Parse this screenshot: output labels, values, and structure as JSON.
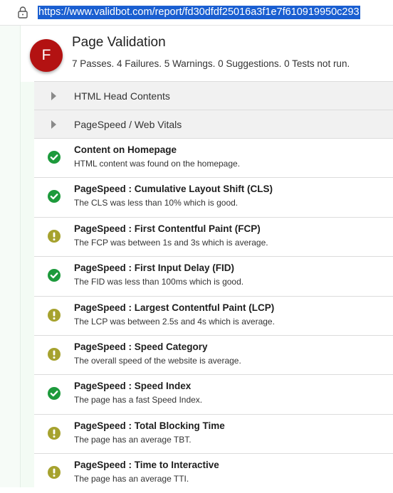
{
  "browser": {
    "url": "https://www.validbot.com/report/fd30dfdf25016a3f1e7f610919950c293"
  },
  "header": {
    "avatar_letter": "F",
    "avatar_color": "#b31212",
    "title": "Page Validation",
    "summary": "7 Passes. 4 Failures. 5 Warnings. 0 Suggestions. 0 Tests not run."
  },
  "sections": [
    {
      "label": "HTML Head Contents"
    },
    {
      "label": "PageSpeed / Web Vitals"
    }
  ],
  "status_colors": {
    "pass": "#1d9a3c",
    "warning": "#a6a22e"
  },
  "checks": [
    {
      "status": "pass",
      "icon": "check-circle-icon",
      "title": "Content on Homepage",
      "desc": "HTML content was found on the homepage."
    },
    {
      "status": "pass",
      "icon": "check-circle-icon",
      "title": "PageSpeed : Cumulative Layout Shift (CLS)",
      "desc": "The CLS was less than 10% which is good."
    },
    {
      "status": "warning",
      "icon": "exclamation-circle-icon",
      "title": "PageSpeed : First Contentful Paint (FCP)",
      "desc": "The FCP was between 1s and 3s which is average."
    },
    {
      "status": "pass",
      "icon": "check-circle-icon",
      "title": "PageSpeed : First Input Delay (FID)",
      "desc": "The FID was less than 100ms which is good."
    },
    {
      "status": "warning",
      "icon": "exclamation-circle-icon",
      "title": "PageSpeed : Largest Contentful Paint (LCP)",
      "desc": "The LCP was between 2.5s and 4s which is average."
    },
    {
      "status": "warning",
      "icon": "exclamation-circle-icon",
      "title": "PageSpeed : Speed Category",
      "desc": "The overall speed of the website is average."
    },
    {
      "status": "pass",
      "icon": "check-circle-icon",
      "title": "PageSpeed : Speed Index",
      "desc": "The page has a fast Speed Index."
    },
    {
      "status": "warning",
      "icon": "exclamation-circle-icon",
      "title": "PageSpeed : Total Blocking Time",
      "desc": "The page has an average TBT."
    },
    {
      "status": "warning",
      "icon": "exclamation-circle-icon",
      "title": "PageSpeed : Time to Interactive",
      "desc": "The page has an average TTI."
    }
  ]
}
